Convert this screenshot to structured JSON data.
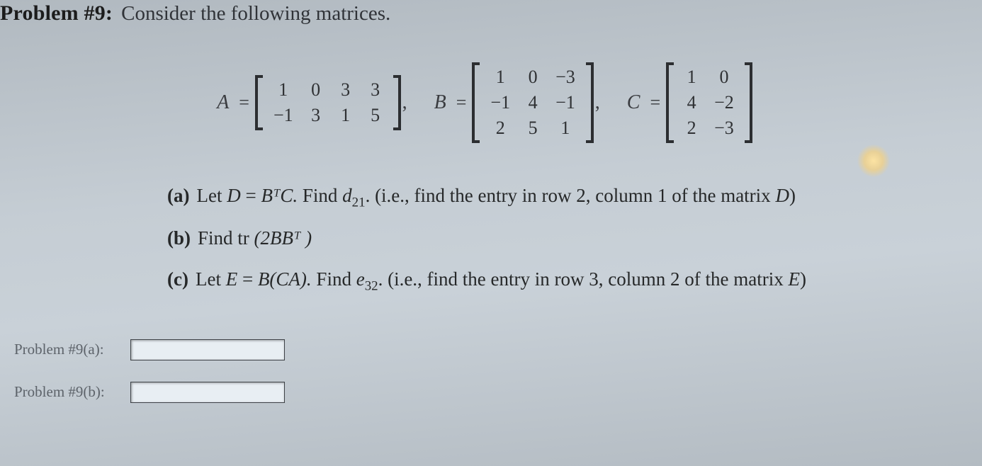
{
  "header": {
    "label": "Problem #9:",
    "prompt": "Consider the following matrices."
  },
  "matrices": {
    "A": {
      "name": "A",
      "rows": 2,
      "cols": 4,
      "values": [
        "1",
        "0",
        "3",
        "3",
        "−1",
        "3",
        "1",
        "5"
      ]
    },
    "B": {
      "name": "B",
      "rows": 3,
      "cols": 3,
      "values": [
        "1",
        "0",
        "−3",
        "−1",
        "4",
        "−1",
        "2",
        "5",
        "1"
      ]
    },
    "C": {
      "name": "C",
      "rows": 3,
      "cols": 2,
      "values": [
        "1",
        "0",
        "4",
        "−2",
        "2",
        "−3"
      ]
    }
  },
  "parts": {
    "a": {
      "label": "(a)",
      "lead": "Let ",
      "def_pre": "D",
      "def_eq": " = ",
      "def_post": "BᵀC.",
      "find": "   Find ",
      "entry_pre": "d",
      "entry_sub": "21",
      "tail": ". (i.e., find the entry in row 2, column 1 of the matrix ",
      "mat": "D",
      "close": ")"
    },
    "b": {
      "label": "(b)",
      "text_pre": "Find tr",
      "text_arg": " (2BBᵀ )"
    },
    "c": {
      "label": "(c)",
      "lead": "Let ",
      "def_pre": "E",
      "def_eq": " = ",
      "def_post": "B(CA).",
      "find": "   Find ",
      "entry_pre": "e",
      "entry_sub": "32",
      "tail": ". (i.e., find the entry in row 3, column 2 of the matrix ",
      "mat": "E",
      "close": ")"
    }
  },
  "inputs": {
    "a_label": "Problem #9(a):",
    "b_label": "Problem #9(b):",
    "a_value": "",
    "b_value": ""
  }
}
